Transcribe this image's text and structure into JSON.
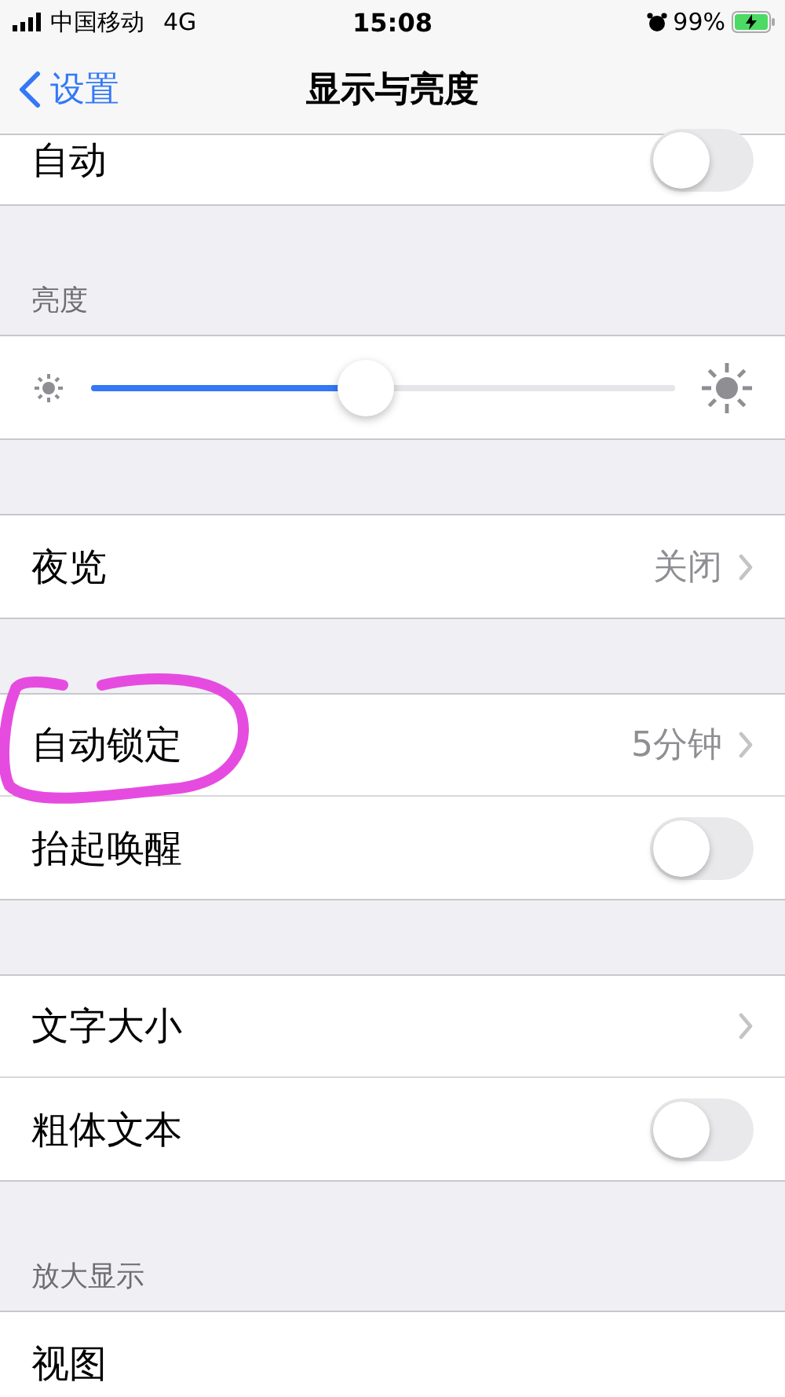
{
  "status_bar": {
    "carrier": "中国移动",
    "network": "4G",
    "time": "15:08",
    "battery": "99%"
  },
  "nav": {
    "back": "设置",
    "title": "显示与亮度"
  },
  "sections": [
    {
      "cut_top": true,
      "rows": [
        {
          "kind": "toggle",
          "label": "自动",
          "on": false
        }
      ]
    },
    {
      "header": "亮度",
      "rows": [
        {
          "kind": "slider",
          "level": 0.47
        }
      ]
    },
    {
      "rows": [
        {
          "kind": "value",
          "label": "夜览",
          "value": "关闭"
        }
      ]
    },
    {
      "rows": [
        {
          "kind": "value",
          "label": "自动锁定",
          "value": "5分钟",
          "circled": true
        },
        {
          "kind": "toggle",
          "label": "抬起唤醒",
          "on": false
        }
      ]
    },
    {
      "rows": [
        {
          "kind": "link",
          "label": "文字大小"
        },
        {
          "kind": "toggle",
          "label": "粗体文本",
          "on": false
        }
      ]
    },
    {
      "header": "放大显示",
      "rows": [
        {
          "kind": "plain",
          "label": "视图"
        }
      ]
    }
  ]
}
